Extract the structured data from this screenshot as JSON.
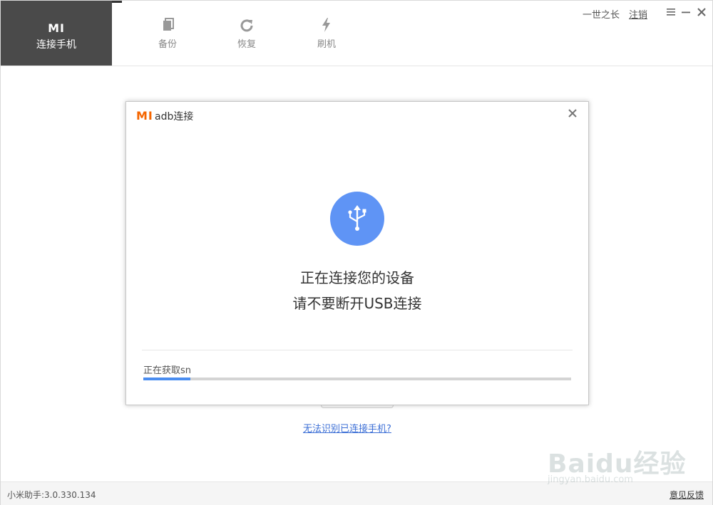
{
  "nav": {
    "active": {
      "logo": "MI",
      "label": "连接手机"
    },
    "items": [
      {
        "label": "备份",
        "icon": "backup-icon"
      },
      {
        "label": "恢复",
        "icon": "restore-icon"
      },
      {
        "label": "刷机",
        "icon": "flash-icon"
      }
    ]
  },
  "header": {
    "username": "一世之长",
    "logout_label": "注销",
    "controls": [
      "menu-icon",
      "minimize-icon",
      "close-icon"
    ]
  },
  "dialog": {
    "logo": "MI",
    "title": "adb连接",
    "close_icon": "close-icon",
    "icon": "usb-icon",
    "message_line1": "正在连接您的设备",
    "message_line2": "请不要断开USB连接",
    "status_text": "正在获取sn",
    "progress_fraction": 0.11
  },
  "main": {
    "cannot_identify_link": "无法识别已连接手机?"
  },
  "statusbar": {
    "version": "小米助手:3.0.330.134",
    "feedback_label": "意见反馈"
  },
  "watermark": {
    "brand": "Baidu经验",
    "url": "jingyan.baidu.com"
  },
  "colors": {
    "accent": "#5f94f5",
    "progress": "#4a8df0",
    "brand_orange": "#f56600",
    "nav_active_bg": "#4a4a4a",
    "link": "#3c6fd6"
  }
}
